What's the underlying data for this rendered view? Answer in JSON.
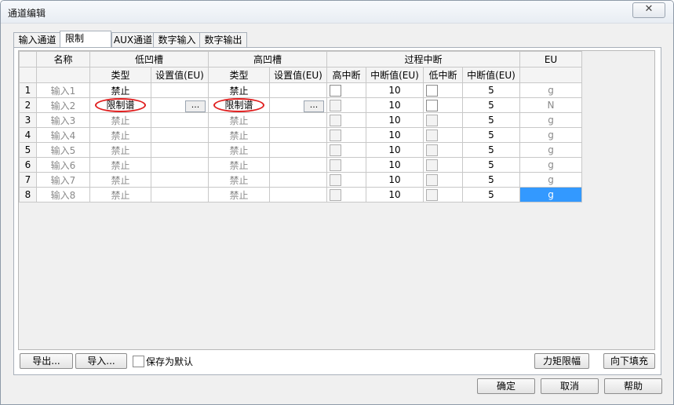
{
  "window": {
    "title": "通道编辑",
    "close_label": "✕"
  },
  "tabs": [
    {
      "label": "输入通道"
    },
    {
      "label": "限制"
    },
    {
      "label": "AUX通道"
    },
    {
      "label": "数字输入"
    },
    {
      "label": "数字输出"
    }
  ],
  "grid": {
    "group_headers": {
      "name": "名称",
      "low_notch": "低凹槽",
      "high_notch": "高凹槽",
      "process_interrupt": "过程中断",
      "eu": "EU"
    },
    "sub_headers": {
      "low_type": "类型",
      "low_setting": "设置值(EU)",
      "high_type": "类型",
      "high_setting": "设置值(EU)",
      "high_interrupt": "高中断",
      "high_interrupt_value": "中断值(EU)",
      "low_interrupt": "低中断",
      "low_interrupt_value": "中断值(EU)"
    },
    "ellipsis_label": "...",
    "rows": [
      {
        "num": "1",
        "name": "输入1",
        "low_type": "禁止",
        "high_type": "禁止",
        "high_val": "10",
        "low_val": "5",
        "eu": "g"
      },
      {
        "num": "2",
        "name": "输入2",
        "low_type": "限制谱",
        "high_type": "限制谱",
        "high_val": "10",
        "low_val": "5",
        "eu": "N"
      },
      {
        "num": "3",
        "name": "输入3",
        "low_type": "禁止",
        "high_type": "禁止",
        "high_val": "10",
        "low_val": "5",
        "eu": "g"
      },
      {
        "num": "4",
        "name": "输入4",
        "low_type": "禁止",
        "high_type": "禁止",
        "high_val": "10",
        "low_val": "5",
        "eu": "g"
      },
      {
        "num": "5",
        "name": "输入5",
        "low_type": "禁止",
        "high_type": "禁止",
        "high_val": "10",
        "low_val": "5",
        "eu": "g"
      },
      {
        "num": "6",
        "name": "输入6",
        "low_type": "禁止",
        "high_type": "禁止",
        "high_val": "10",
        "low_val": "5",
        "eu": "g"
      },
      {
        "num": "7",
        "name": "输入7",
        "low_type": "禁止",
        "high_type": "禁止",
        "high_val": "10",
        "low_val": "5",
        "eu": "g"
      },
      {
        "num": "8",
        "name": "输入8",
        "low_type": "禁止",
        "high_type": "禁止",
        "high_val": "10",
        "low_val": "5",
        "eu": "g"
      }
    ]
  },
  "bottom": {
    "export_label": "导出...",
    "import_label": "导入...",
    "save_default_label": "保存为默认",
    "torque_limit_label": "力矩限幅",
    "fill_down_label": "向下填充",
    "ok_label": "确定",
    "cancel_label": "取消",
    "help_label": "帮助"
  },
  "colors": {
    "selected_cell": "#3399ff",
    "highlight_circle": "#e02020"
  }
}
